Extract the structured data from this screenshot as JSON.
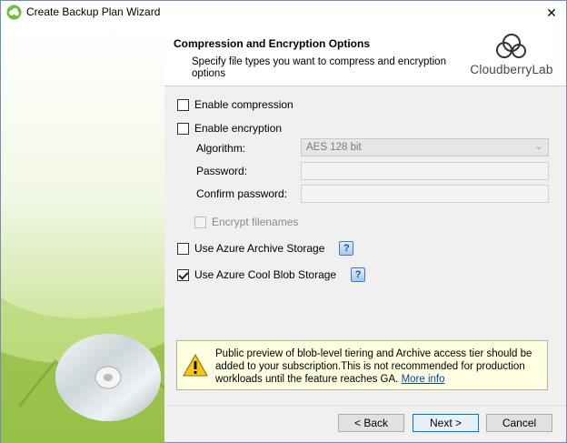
{
  "window": {
    "title": "Create Backup Plan Wizard",
    "close_glyph": "✕"
  },
  "header": {
    "title": "Compression and Encryption Options",
    "subtitle": "Specify file types you want to compress and encryption options",
    "logo_text": "CloudberryLab"
  },
  "options": {
    "enable_compression": {
      "label": "Enable compression",
      "checked": false
    },
    "enable_encryption": {
      "label": "Enable encryption",
      "checked": false
    },
    "algorithm_label": "Algorithm:",
    "algorithm_value": "AES 128 bit",
    "password_label": "Password:",
    "confirm_password_label": "Confirm password:",
    "encrypt_filenames": {
      "label": "Encrypt filenames",
      "checked": false,
      "disabled": true
    },
    "azure_archive": {
      "label": "Use Azure Archive Storage",
      "checked": false
    },
    "azure_cool": {
      "label": "Use Azure Cool Blob Storage",
      "checked": true
    },
    "help_glyph": "?"
  },
  "warning": {
    "text": "Public preview of blob-level tiering and Archive access tier should be added to your subscription.This is not recommended for production workloads until the feature reaches GA. ",
    "link": "More info"
  },
  "buttons": {
    "back": "< Back",
    "next": "Next >",
    "cancel": "Cancel"
  },
  "colors": {
    "sidebar_green": "#9cc54a",
    "warning_bg": "#ffffe1",
    "primary_border": "#0078d7"
  }
}
